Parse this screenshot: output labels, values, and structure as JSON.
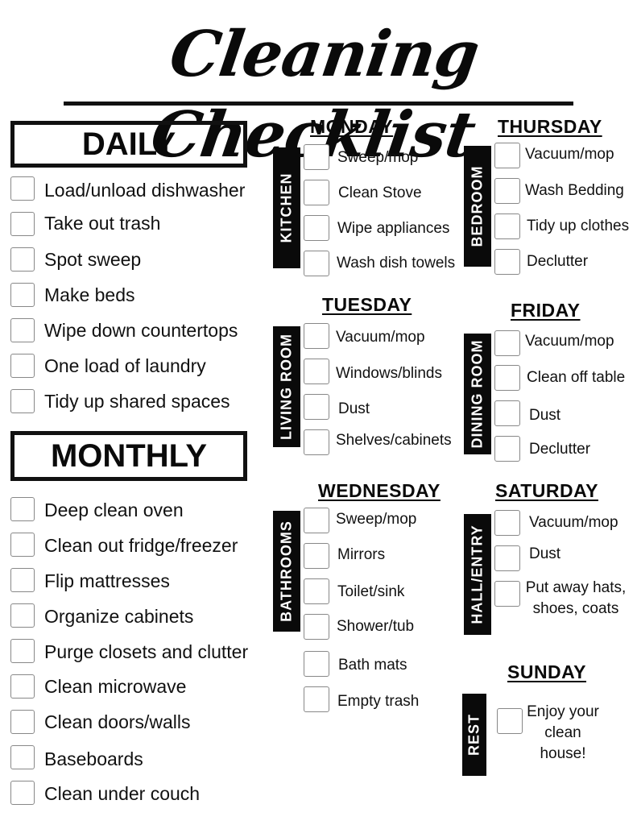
{
  "title": "Cleaning Checklist",
  "daily": {
    "heading": "DAILY",
    "items": [
      "Load/unload dishwasher",
      "Take out trash",
      "Spot sweep",
      "Make beds",
      "Wipe down countertops",
      "One load of laundry",
      "Tidy up shared spaces"
    ]
  },
  "monthly": {
    "heading": "MONTHLY",
    "items": [
      "Deep clean oven",
      "Clean out fridge/freezer",
      "Flip mattresses",
      "Organize cabinets",
      "Purge closets and clutter",
      "Clean microwave",
      "Clean doors/walls",
      "Baseboards",
      "Clean under couch"
    ]
  },
  "days": {
    "monday": {
      "day": "MONDAY",
      "room": "KITCHEN",
      "items": [
        "Sweep/mop",
        "Clean Stove",
        "Wipe appliances",
        "Wash dish towels"
      ]
    },
    "tuesday": {
      "day": "TUESDAY",
      "room": "LIVING ROOM",
      "items": [
        "Vacuum/mop",
        "Windows/blinds",
        "Dust",
        "Shelves/cabinets"
      ]
    },
    "wednesday": {
      "day": "WEDNESDAY",
      "room": "BATHROOMS",
      "items": [
        "Sweep/mop",
        "Mirrors",
        "Toilet/sink",
        "Shower/tub",
        "Bath mats",
        "Empty trash"
      ]
    },
    "thursday": {
      "day": "THURSDAY",
      "room": "BEDROOM",
      "items": [
        "Vacuum/mop",
        "Wash Bedding",
        "Tidy up clothes",
        "Declutter"
      ]
    },
    "friday": {
      "day": "FRIDAY",
      "room": "DINING ROOM",
      "items": [
        "Vacuum/mop",
        "Clean off table",
        "Dust",
        "Declutter"
      ]
    },
    "saturday": {
      "day": "SATURDAY",
      "room": "HALL/ENTRY",
      "items": [
        "Vacuum/mop",
        "Dust",
        "Put away hats, shoes, coats"
      ]
    },
    "sunday": {
      "day": "SUNDAY",
      "room": "REST",
      "items": [
        "Enjoy your clean house!"
      ]
    }
  }
}
